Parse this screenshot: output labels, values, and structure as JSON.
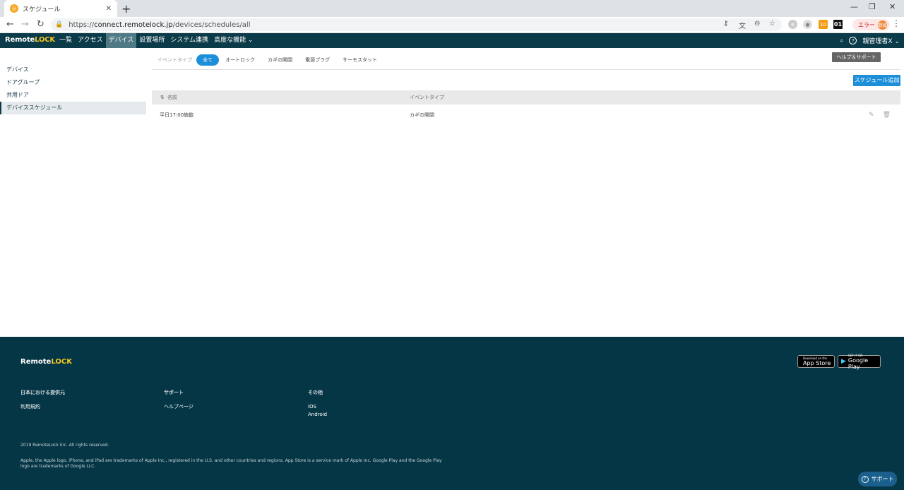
{
  "browser": {
    "tab_title": "スケジュール",
    "url_scheme": "https://",
    "url_host": "connect.remotelock.jp",
    "url_path": "/devices/schedules/all",
    "ext_badge": "10",
    "ext_label": "01",
    "error_label": "エラー",
    "profile_label": "数値"
  },
  "app": {
    "logo_remote": "Remote",
    "logo_lock": "LOCK",
    "nav": [
      "一覧",
      "アクセス",
      "デバイス",
      "設置場所",
      "システム連携",
      "高度な機能 ⌄"
    ],
    "admin_label": "親管理者X ⌄"
  },
  "sidebar": {
    "items": [
      "デバイス",
      "ドアグループ",
      "共用ドア",
      "デバイススケジュール"
    ]
  },
  "filters": {
    "label": "イベントタイプ",
    "chips": [
      "全て",
      "オートロック",
      "カギの開閉",
      "電源プラグ",
      "サーモスタット"
    ]
  },
  "help_button": "ヘルプ＆サポート",
  "add_button": "スケジュール追加",
  "table": {
    "headers": [
      "名前",
      "イベントタイプ"
    ],
    "rows": [
      {
        "name": "平日17:00施錠",
        "event_type": "カギの開閉"
      }
    ]
  },
  "footer": {
    "app_store_small": "Download on the",
    "app_store": "App Store",
    "google_play_small": "GET IT ON",
    "google_play": "Google Play",
    "col1_head": "日本における提供元",
    "col1_links": [
      "利用規約"
    ],
    "col2_head": "サポート",
    "col2_links": [
      "ヘルプページ"
    ],
    "col3_head": "その他",
    "col3_links": [
      "iOS",
      "Android"
    ],
    "copyright": "2019 RemoteLock Inc. All rights reserved.",
    "legal": "Apple, the Apple logo, iPhone, and iPad are trademarks of Apple Inc., registered in the U.S. and other countries and regions. App Store is a service mark of Apple Inc. Google Play and the Google Play logo are trademarks of Google LLC."
  },
  "support_button": "サポート"
}
